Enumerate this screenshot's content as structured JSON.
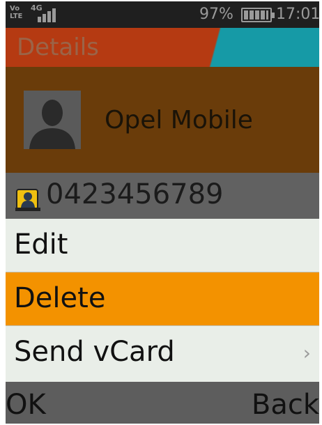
{
  "status_bar": {
    "volte_line1": "Vo",
    "volte_line2": "LTE",
    "network": "4G",
    "battery_percent": "97%",
    "battery_level": 0.97,
    "time": "17:01"
  },
  "header": {
    "title": "Details",
    "colors": {
      "primary": "#b53a12",
      "accent": "#169aa6"
    }
  },
  "contact": {
    "name": "Opel Mobile",
    "avatar_icon": "person-silhouette-icon",
    "phone_icon": "contact-card-icon",
    "phone": "0423456789"
  },
  "menu": {
    "items": [
      {
        "label": "Edit",
        "selected": false
      },
      {
        "label": "Delete",
        "selected": true
      },
      {
        "label": "Send vCard",
        "selected": false,
        "chevron": "›"
      }
    ],
    "highlight_color": "#f39200"
  },
  "softkeys": {
    "left": "OK",
    "right": "Back"
  }
}
